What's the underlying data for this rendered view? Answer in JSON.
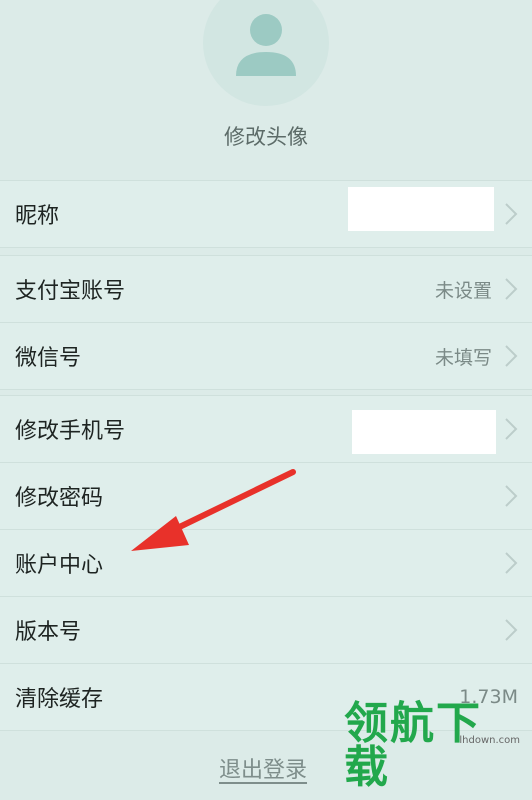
{
  "profile": {
    "avatar_caption": "修改头像"
  },
  "settings": {
    "nickname": {
      "label": "昵称"
    },
    "alipay": {
      "label": "支付宝账号",
      "value": "未设置"
    },
    "wechat": {
      "label": "微信号",
      "value": "未填写"
    },
    "phone": {
      "label": "修改手机号"
    },
    "password": {
      "label": "修改密码"
    },
    "account": {
      "label": "账户中心"
    },
    "version": {
      "label": "版本号"
    },
    "cache": {
      "label": "清除缓存",
      "value": "1.73M"
    }
  },
  "logout_label": "退出登录",
  "watermark": {
    "text": "领航下载",
    "site": "lhdown.com"
  },
  "colors": {
    "annotation_arrow": "#e8312a",
    "watermark": "#22a84c"
  }
}
